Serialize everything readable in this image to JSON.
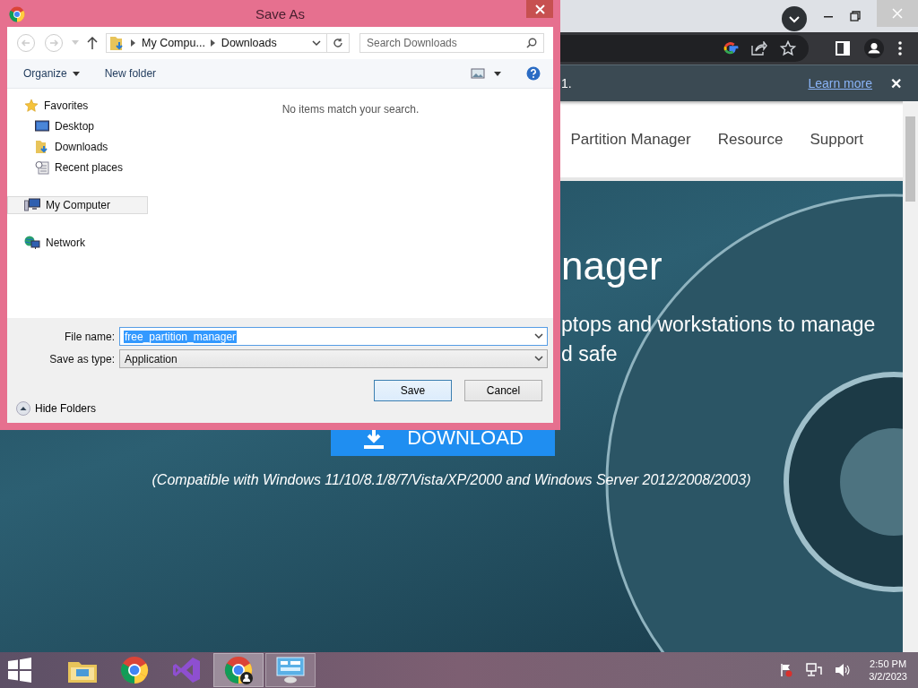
{
  "browser": {
    "toolbar_icons": [
      {
        "kind": "google"
      },
      {
        "kind": "share"
      },
      {
        "kind": "star"
      },
      {
        "kind": "sidebar"
      },
      {
        "kind": "profile"
      },
      {
        "kind": "menu"
      }
    ],
    "infobar": {
      "text": "1.",
      "link": "Learn more",
      "close": "✕"
    },
    "nav": [
      "Partition Manager",
      "Resource",
      "Support"
    ],
    "hero": {
      "heading": "nager",
      "subtitle": [
        "ptops and workstations to manage",
        "d safe"
      ],
      "download": "DOWNLOAD",
      "compatibility": "(Compatible with Windows 11/10/8.1/8/7/Vista/XP/2000 and Windows Server 2012/2008/2003)"
    }
  },
  "dialog": {
    "title": "Save As",
    "breadcrumb": [
      "My Compu...",
      "Downloads"
    ],
    "search": {
      "placeholder": "Search Downloads"
    },
    "commands": [
      "Organize",
      "New folder"
    ],
    "empty_message": "No items match your search.",
    "tree": [
      {
        "label": "Favorites",
        "kind": "star",
        "selected": false,
        "children": [
          {
            "label": "Desktop",
            "kind": "desktop",
            "selected": false
          },
          {
            "label": "Downloads",
            "kind": "downloads",
            "selected": false
          },
          {
            "label": "Recent places",
            "kind": "recent",
            "selected": false
          }
        ]
      },
      {
        "label": "My Computer",
        "kind": "computer",
        "selected": true
      },
      {
        "label": "Network",
        "kind": "network",
        "selected": false
      }
    ],
    "file_name": {
      "label": "File name:",
      "value": "free_partition_manager",
      "text_selected": true
    },
    "save_type": {
      "label": "Save as type:",
      "value": "Application"
    },
    "hide_folders": "Hide Folders",
    "buttons": [
      {
        "label": "Save",
        "default": true
      },
      {
        "label": "Cancel",
        "default": false
      }
    ]
  },
  "taskbar": {
    "apps": [
      {
        "kind": "explorer",
        "open": false,
        "selected": false
      },
      {
        "kind": "chrome",
        "open": false,
        "selected": false
      },
      {
        "kind": "visual-studio",
        "open": false,
        "selected": false
      },
      {
        "kind": "chrome-profile",
        "open": true,
        "selected": true
      },
      {
        "kind": "control-panel",
        "open": true,
        "selected": false
      }
    ],
    "time": "2:50 PM",
    "date": "3/2/2023"
  }
}
